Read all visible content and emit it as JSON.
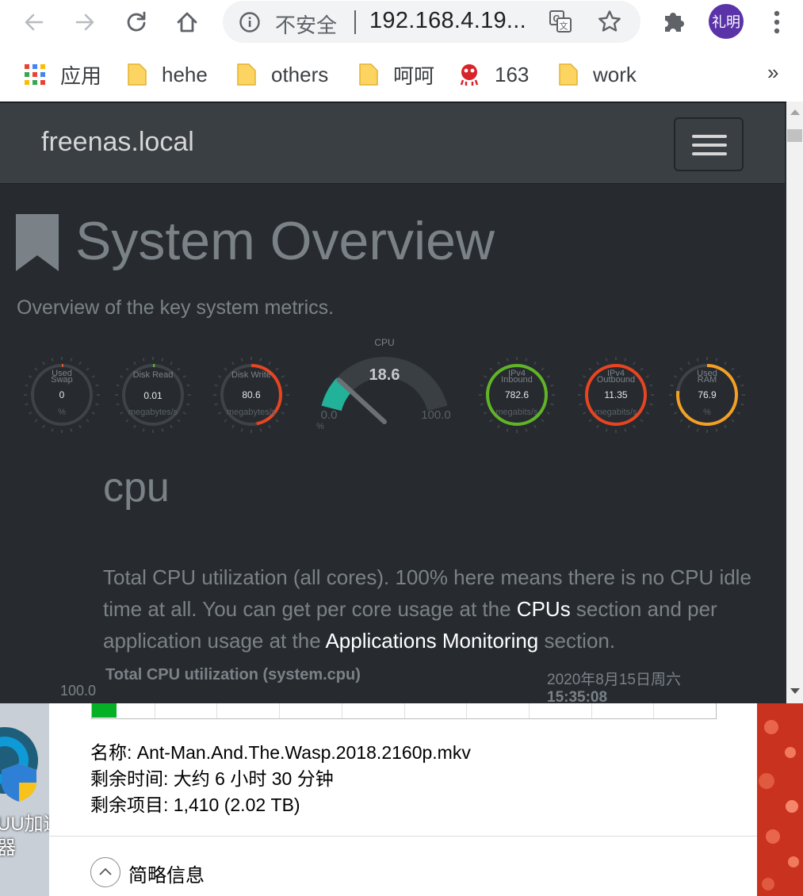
{
  "browser": {
    "security_text": "不安全",
    "url": "192.168.4.19...",
    "avatar_text": "礼明",
    "bookmarks": [
      {
        "label": "应用",
        "icon": "apps-grid-icon"
      },
      {
        "label": "hehe",
        "icon": "folder-icon"
      },
      {
        "label": "others",
        "icon": "folder-icon"
      },
      {
        "label": "呵呵",
        "icon": "folder-icon"
      },
      {
        "label": "163",
        "icon": "163-mail-icon"
      },
      {
        "label": "work",
        "icon": "folder-icon"
      }
    ],
    "bookmarks_overflow": "»"
  },
  "page": {
    "brand": "freenas.local",
    "title": "System Overview",
    "subtitle": "Overview of the key system metrics.",
    "section_heading": "cpu",
    "section_text": {
      "part1": "Total CPU utilization (all cores). 100% here means there is no CPU idle time at all. You can get per core usage at the ",
      "link1": "CPUs",
      "part2": " section and per application usage at the ",
      "link2": "Applications Monitoring",
      "part3": " section."
    },
    "chart": {
      "title": "Total CPU utilization (system.cpu)",
      "date": "2020年8月15日周六",
      "time": "15:35:08",
      "ymax_label": "100.0"
    },
    "gauges": [
      {
        "label": [
          "Used",
          "Swap"
        ],
        "value": "0",
        "unit": "%",
        "fraction": 0.0,
        "color": "#e05d2c"
      },
      {
        "label": [
          "Disk Read"
        ],
        "value": "0.01",
        "unit": "megabytes/s",
        "fraction": 0.01,
        "color": "#5fb526"
      },
      {
        "label": [
          "Disk Write"
        ],
        "value": "80.6",
        "unit": "megabytes/s",
        "fraction": 0.47,
        "color": "#e84420"
      },
      {
        "label": [
          "IPv4",
          "Inbound"
        ],
        "value": "782.6",
        "unit": "megabits/s",
        "fraction": 1.0,
        "color": "#5fb526"
      },
      {
        "label": [
          "IPv4",
          "Outbound"
        ],
        "value": "11.35",
        "unit": "megabits/s",
        "fraction": 1.0,
        "color": "#e84420"
      },
      {
        "label": [
          "Used",
          "RAM"
        ],
        "value": "76.9",
        "unit": "%",
        "fraction": 0.77,
        "color": "#f4a024"
      }
    ],
    "cpu_gauge": {
      "title": "CPU",
      "value": "18.6",
      "min_label": "0.0",
      "max_label": "100.0",
      "unit": "%",
      "fraction": 0.186,
      "color": "#22b199"
    }
  },
  "dialog": {
    "progress_fraction": 0.04,
    "name_line": "名称: Ant-Man.And.The.Wasp.2018.2160p.mkv",
    "time_line": "剩余时间: 大约 6 小时 30 分钟",
    "items_line": "剩余项目: 1,410 (2.02 TB)",
    "collapse_label": "简略信息"
  },
  "desktop": {
    "label_line1": "UU加速",
    "label_line2": "器"
  }
}
